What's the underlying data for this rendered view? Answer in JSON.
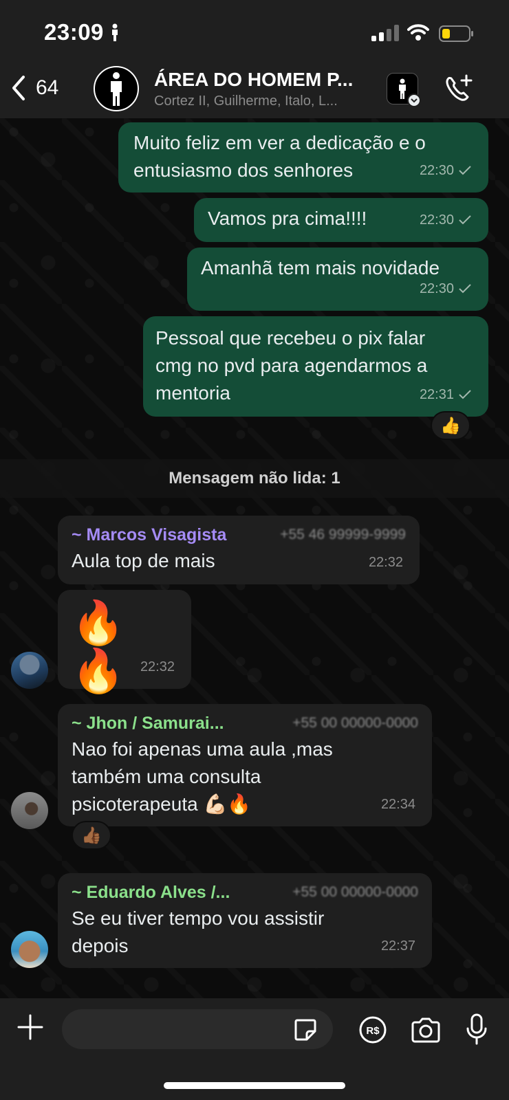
{
  "status_bar": {
    "time": "23:09"
  },
  "header": {
    "back_count": "64",
    "group_title": "ÁREA DO HOMEM P...",
    "group_members": "Cortez II, Guilherme, Italo, L..."
  },
  "messages": [
    {
      "text": "Muito feliz em ver a dedicação e o\nentusiasmo dos senhores",
      "time": "22:30"
    },
    {
      "text": "Vamos pra cima!!!!",
      "time": "22:30"
    },
    {
      "text": "Amanhã tem mais novidade",
      "time": "22:30"
    },
    {
      "text": "Pessoal que recebeu o pix falar\ncmg no pvd para agendarmos a\nmentoria",
      "time": "22:31",
      "reaction": "👍"
    }
  ],
  "unread_divider": "Mensagem não lida: 1",
  "incoming": [
    {
      "sender": "~ Marcos Visagista",
      "phone": "+55 46 99999-9999",
      "text": "Aula top de mais",
      "time": "22:32",
      "color": "#a58bf5"
    },
    {
      "text": "🔥 🔥",
      "time": "22:32"
    },
    {
      "sender": "~ Jhon / Samurai...",
      "phone": "+55 00 00000-0000",
      "text": "Nao foi apenas uma aula ,mas\ntambém uma consulta\npsicoterapeuta 💪🏻🔥",
      "time": "22:34",
      "color": "#8be08b",
      "reaction": "👍🏾"
    },
    {
      "sender": "~ Eduardo Alves /...",
      "phone": "+55 00 00000-0000",
      "text": "Se eu tiver tempo vou assistir\ndepois",
      "time": "22:37",
      "color": "#8be08b"
    }
  ],
  "input": {
    "placeholder": ""
  },
  "colors": {
    "outgoing": "#144d37",
    "incoming": "#1f1f1f",
    "background": "#0c0c0c",
    "bar": "#1f1f1f"
  }
}
